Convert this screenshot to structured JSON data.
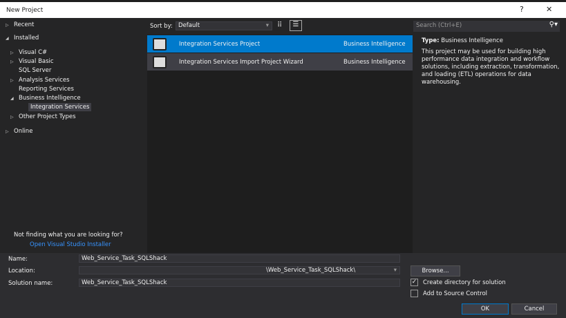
{
  "window": {
    "title": "New Project",
    "help": "?",
    "close": "✕"
  },
  "tree": {
    "recent": "Recent",
    "installed": "Installed",
    "visual_csharp": "Visual C#",
    "visual_basic": "Visual Basic",
    "sql_server": "SQL Server",
    "analysis": "Analysis Services",
    "reporting": "Reporting Services",
    "bi": "Business Intelligence",
    "integration": "Integration Services",
    "other": "Other Project Types",
    "online": "Online"
  },
  "notfound": {
    "text": "Not finding what you are looking for?",
    "link": "Open Visual Studio Installer"
  },
  "sort": {
    "label": "Sort by:",
    "value": "Default"
  },
  "templates": [
    {
      "name": "Integration Services Project",
      "category": "Business Intelligence"
    },
    {
      "name": "Integration Services Import Project Wizard",
      "category": "Business Intelligence"
    }
  ],
  "search": {
    "placeholder": "Search (Ctrl+E)"
  },
  "details": {
    "type_label": "Type:",
    "type_value": "Business Intelligence",
    "description": "This project may be used for building high performance data integration and workflow solutions, including extraction, transformation, and loading (ETL) operations for data warehousing."
  },
  "form": {
    "name_label": "Name:",
    "name_value": "Web_Service_Task_SQLShack",
    "location_label": "Location:",
    "location_value": "\\Web_Service_Task_SQLShack\\",
    "solution_label": "Solution name:",
    "solution_value": "Web_Service_Task_SQLShack",
    "browse": "Browse...",
    "create_dir": "Create directory for solution",
    "source_control": "Add to Source Control",
    "ok": "OK",
    "cancel": "Cancel"
  }
}
